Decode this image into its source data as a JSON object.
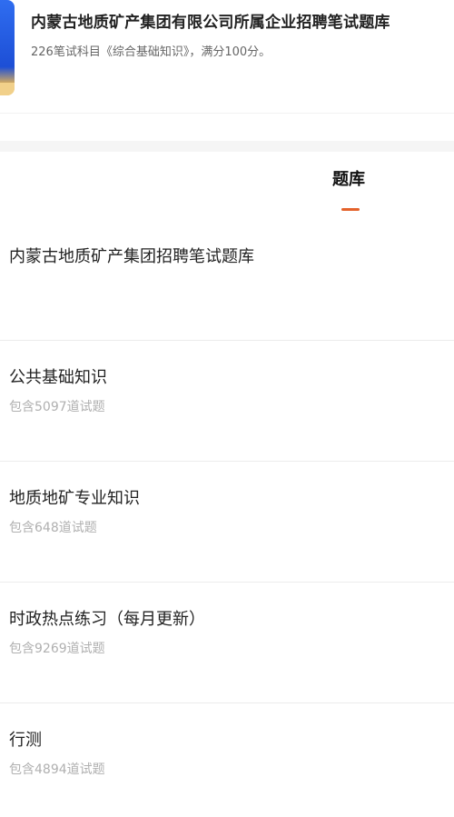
{
  "exam": {
    "title": "内蒙古地质矿产集团有限公司所属企业招聘笔试题库",
    "subtitle": "226笔试科目《综合基础知识》，满分100分。"
  },
  "tabs": [
    {
      "label": "题库",
      "active": true
    }
  ],
  "section": {
    "heading": "内蒙古地质矿产集团招聘笔试题库"
  },
  "banks": [
    {
      "name": "公共基础知识",
      "count": "包含5097道试题"
    },
    {
      "name": "地质地矿专业知识",
      "count": "包含648道试题"
    },
    {
      "name": "时政热点练习（每月更新）",
      "count": "包含9269道试题"
    },
    {
      "name": "行测",
      "count": "包含4894道试题"
    }
  ],
  "colors": {
    "accent": "#e4622b",
    "muted_text": "#b0b0b0",
    "cover_blue": "#2f6df0"
  }
}
